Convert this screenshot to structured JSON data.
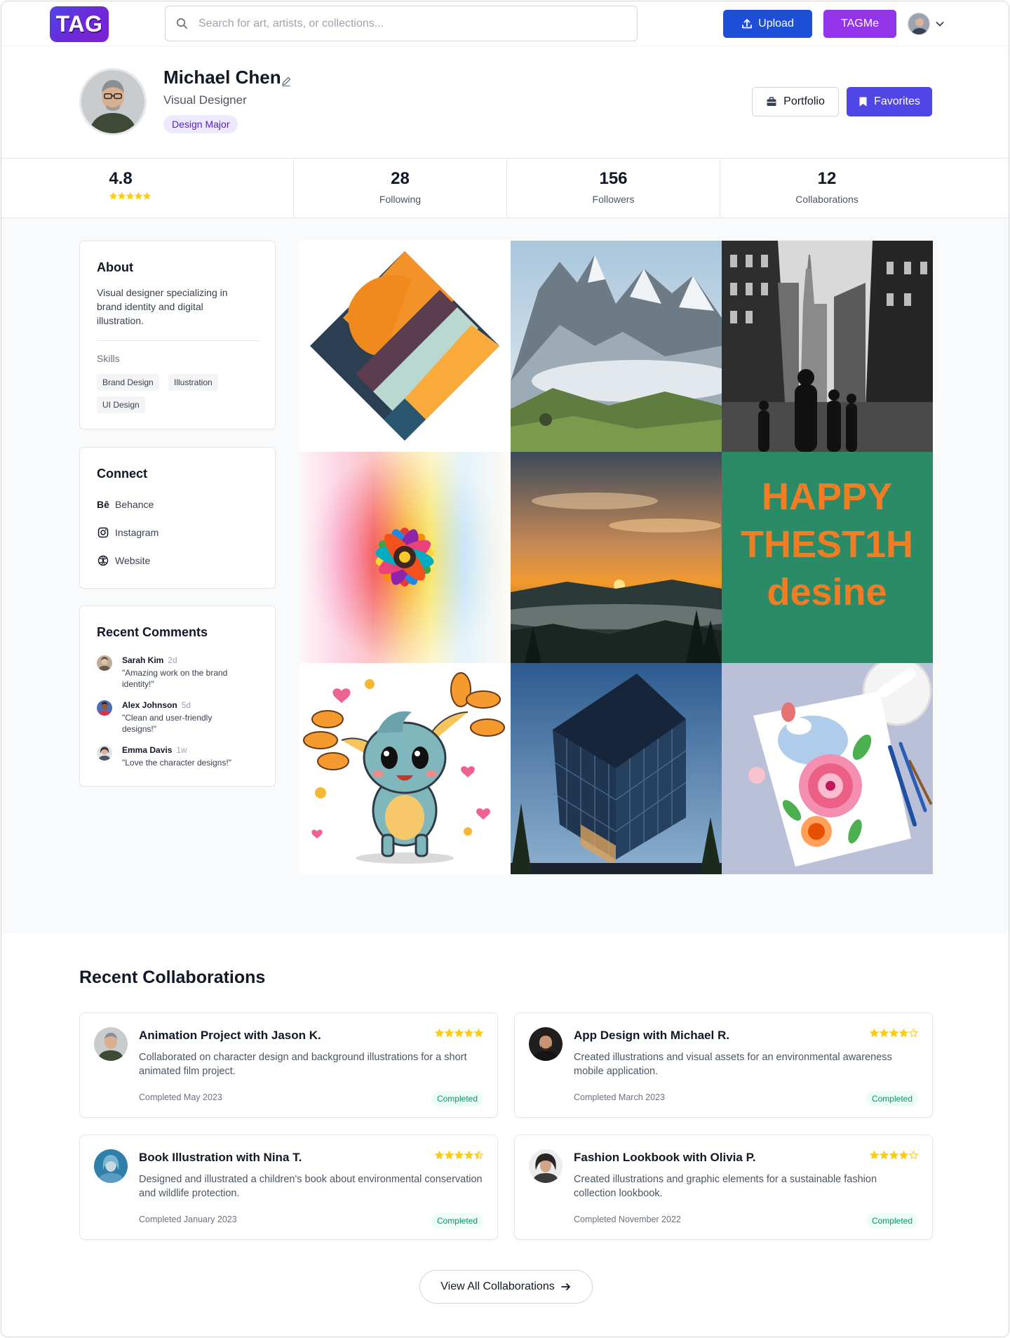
{
  "brand": {
    "logo_text": "TAG",
    "gradient": [
      "#4f46e5",
      "#7e22ce"
    ]
  },
  "search": {
    "placeholder": "Search for art, artists, or collections..."
  },
  "nav": {
    "upload_label": "Upload",
    "tagme_label": "TAGMe",
    "icons": [
      "search-icon",
      "upload-icon",
      "chevron-down-icon"
    ]
  },
  "profile": {
    "name": "Michael Chen",
    "role": "Visual Designer",
    "badge": "Design Major",
    "portfolio_label": "Portfolio",
    "favorites_label": "Favorites"
  },
  "stats": {
    "rating": "4.8",
    "rating_stars": 5,
    "following_count": "28",
    "following_label": "Following",
    "followers_count": "156",
    "followers_label": "Followers",
    "collaborations_count": "12",
    "collaborations_label": "Collaborations"
  },
  "about": {
    "title": "About",
    "text": "Visual designer specializing in brand identity and digital illustration.",
    "skills_label": "Skills",
    "skills": [
      "Brand Design",
      "Illustration",
      "UI Design"
    ]
  },
  "connect": {
    "title": "Connect",
    "links": [
      {
        "label": "Behance",
        "icon": "behance-icon"
      },
      {
        "label": "Instagram",
        "icon": "instagram-icon"
      },
      {
        "label": "Website",
        "icon": "globe-icon"
      }
    ]
  },
  "comments": {
    "title": "Recent Comments",
    "items": [
      {
        "name": "Sarah Kim",
        "time": "2d",
        "text": "\"Amazing work on the brand identity!\""
      },
      {
        "name": "Alex Johnson",
        "time": "5d",
        "text": "\"Clean and user-friendly designs!\""
      },
      {
        "name": "Emma Davis",
        "time": "1w",
        "text": "\"Love the character designs!\""
      }
    ]
  },
  "gallery": {
    "tiles": [
      {
        "subject": "abstract-logo"
      },
      {
        "subject": "mountain-landscape"
      },
      {
        "subject": "city-street"
      },
      {
        "subject": "rainbow-flower"
      },
      {
        "subject": "sunset-hills"
      },
      {
        "subject": "typography-poster",
        "lines": [
          "HAPPY",
          "THEST1H",
          "desine"
        ]
      },
      {
        "subject": "cartoon-character"
      },
      {
        "subject": "glass-building"
      },
      {
        "subject": "watercolor-flowers"
      }
    ]
  },
  "collaborations": {
    "title": "Recent Collaborations",
    "items": [
      {
        "title": "Animation Project with Jason K.",
        "rating": 5,
        "description": "Collaborated on character design and background illustrations for a short animated film project.",
        "date": "Completed May 2023",
        "status": "Completed"
      },
      {
        "title": "App Design with Michael R.",
        "rating": 4,
        "description": "Created illustrations and visual assets for an environmental awareness mobile application.",
        "date": "Completed March 2023",
        "status": "Completed"
      },
      {
        "title": "Book Illustration with Nina T.",
        "rating": 4.5,
        "description": "Designed and illustrated a children's book about environmental conservation and wildlife protection.",
        "date": "Completed January 2023",
        "status": "Completed"
      },
      {
        "title": "Fashion Lookbook with Olivia P.",
        "rating": 4,
        "description": "Created illustrations and graphic elements for a sustainable fashion collection lookbook.",
        "date": "Completed November 2022",
        "status": "Completed"
      }
    ],
    "view_all_label": "View All Collaborations"
  },
  "colors": {
    "primary": "#4f46e5",
    "upload": "#1d4ed8",
    "tagme": "#9333ea",
    "star": "#facc15",
    "success": "#059669"
  }
}
